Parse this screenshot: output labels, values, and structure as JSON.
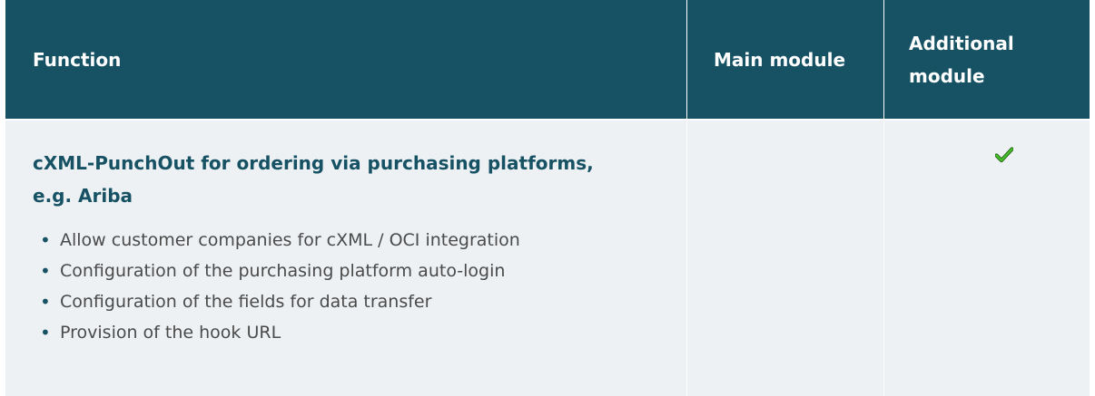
{
  "header": {
    "function_label": "Function",
    "main_label": "Main module",
    "additional_label_line1": "Additional",
    "additional_label_line2": "module"
  },
  "row": {
    "title_line1": "cXML-PunchOut for ordering via purchasing platforms,",
    "title_line2": "e.g. Ariba",
    "items": [
      "Allow customer companies for cXML / OCI integration",
      "Configuration of the purchasing platform auto-login",
      "Configuration of the fields for data transfer",
      "Provision of the hook URL"
    ],
    "main_module_included": false,
    "additional_module_included": true
  },
  "colors": {
    "header_bg": "#165264",
    "row_bg": "#eef1f4",
    "accent": "#165264",
    "check": "#2e9e1c"
  },
  "icons": {
    "included": "check-icon",
    "bullet": "bullet"
  }
}
